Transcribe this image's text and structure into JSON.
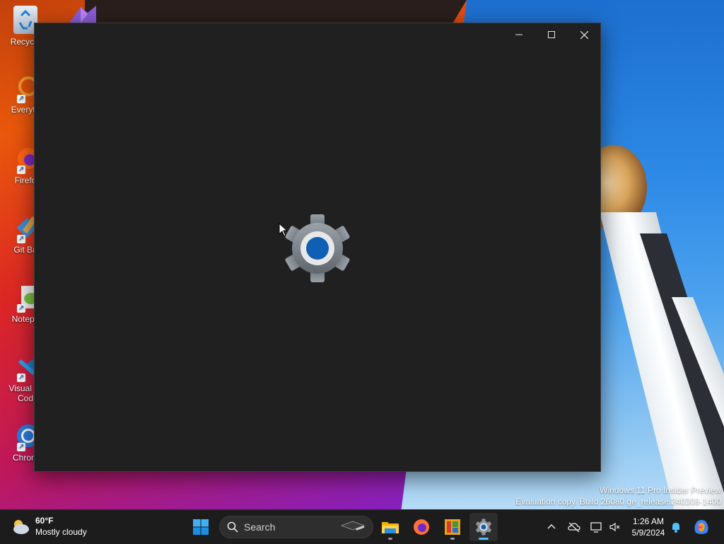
{
  "desktop": {
    "icons": [
      {
        "label": "Recycle",
        "icon": "recycle-bin-icon"
      },
      {
        "label": "Everyth",
        "icon": "everything-icon"
      },
      {
        "label": "Firefo",
        "icon": "firefox-icon"
      },
      {
        "label": "Git Ba",
        "icon": "git-bash-icon"
      },
      {
        "label": "Notepa",
        "icon": "notepad-plus-icon"
      },
      {
        "label": "Visual St",
        "label2": "Cod",
        "icon": "vscode-icon"
      },
      {
        "label": "Chrom",
        "icon": "chrome-icon"
      }
    ],
    "watermark": {
      "line1": "Windows 11 Pro Insider Preview",
      "line2": "Evaluation copy. Build 26080.ge_release.240308-1400"
    }
  },
  "window": {
    "app": "Settings",
    "splash_icon": "gear-icon",
    "accent": "#0067c0"
  },
  "taskbar": {
    "weather": {
      "temp": "60°F",
      "condition": "Mostly cloudy",
      "icon": "cloudy-weather-icon"
    },
    "search_label": "Search",
    "clock": {
      "time": "1:26 AM",
      "date": "5/9/2024"
    },
    "apps": [
      {
        "name": "file-explorer",
        "icon": "folder-icon"
      },
      {
        "name": "firefox",
        "icon": "firefox-icon"
      },
      {
        "name": "color-app",
        "icon": "color-grid-icon"
      },
      {
        "name": "settings",
        "icon": "gear-icon",
        "active": true
      }
    ]
  }
}
